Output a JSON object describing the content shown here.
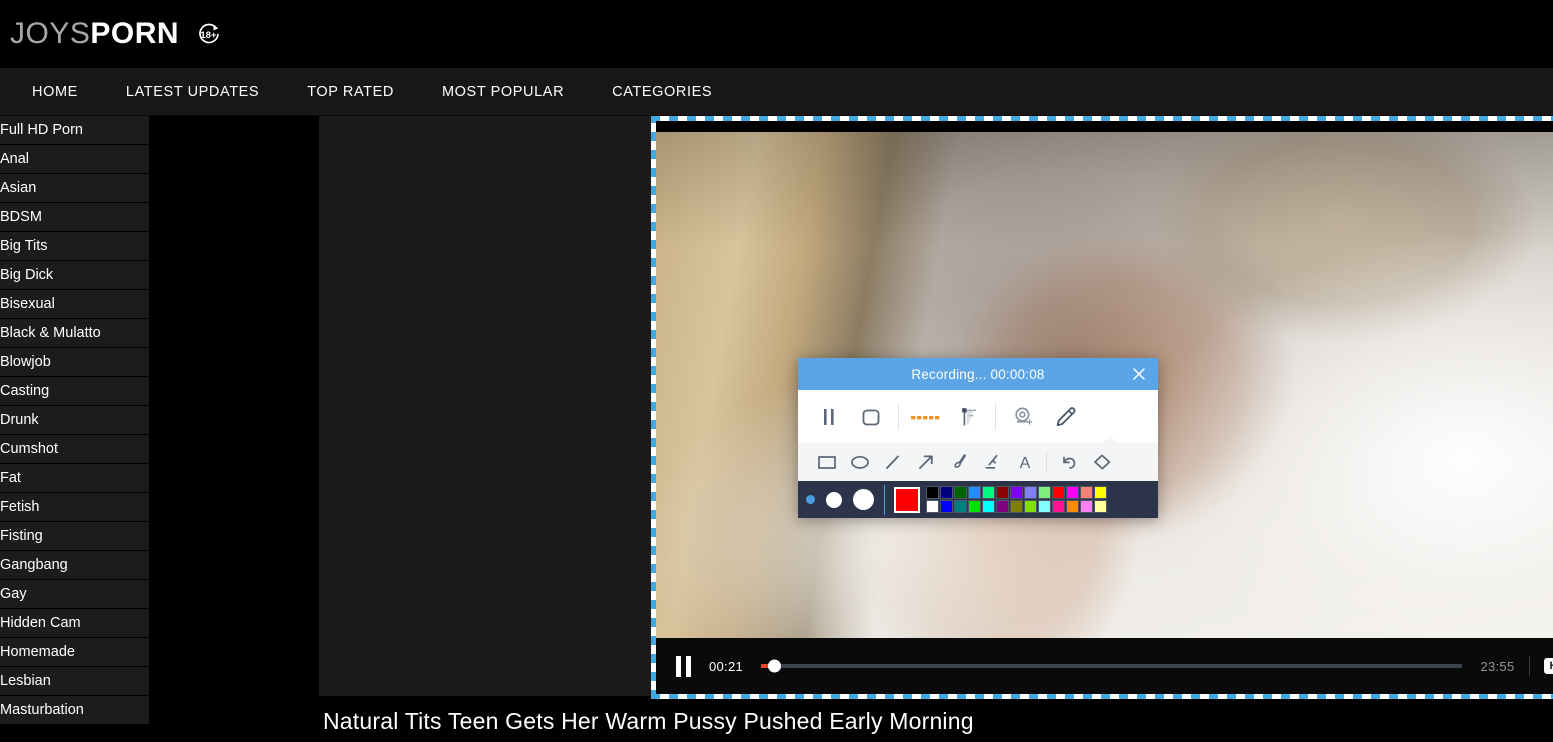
{
  "header": {
    "logo_primary": "JOYS",
    "logo_secondary": "PORN",
    "age_badge": "18+"
  },
  "nav": {
    "items": [
      {
        "label": "HOME"
      },
      {
        "label": "LATEST UPDATES"
      },
      {
        "label": "TOP RATED"
      },
      {
        "label": "MOST POPULAR"
      },
      {
        "label": "CATEGORIES"
      }
    ]
  },
  "sidebar": {
    "items": [
      {
        "label": "Full HD Porn"
      },
      {
        "label": "Anal"
      },
      {
        "label": "Asian"
      },
      {
        "label": "BDSM"
      },
      {
        "label": "Big Tits"
      },
      {
        "label": "Big Dick"
      },
      {
        "label": "Bisexual"
      },
      {
        "label": "Black & Mulatto"
      },
      {
        "label": "Blowjob"
      },
      {
        "label": "Casting"
      },
      {
        "label": "Drunk"
      },
      {
        "label": "Cumshot"
      },
      {
        "label": "Fat"
      },
      {
        "label": "Fetish"
      },
      {
        "label": "Fisting"
      },
      {
        "label": "Gangbang"
      },
      {
        "label": "Gay"
      },
      {
        "label": "Hidden Cam"
      },
      {
        "label": "Homemade"
      },
      {
        "label": "Lesbian"
      },
      {
        "label": "Masturbation"
      }
    ]
  },
  "video": {
    "title": "Natural Tits Teen Gets Her Warm Pussy Pushed Early Morning",
    "current_time": "00:21",
    "duration": "23:55",
    "progress_percent": 1.4,
    "quality_badge": "HD",
    "state": "playing",
    "controls": {
      "pause": "pause-button",
      "volume": "volume-button",
      "fullscreen": "fullscreen-button"
    }
  },
  "recorder": {
    "status_text": "Recording... 00:00:08",
    "close_label": "close",
    "toolbar": [
      {
        "name": "pause-recording",
        "icon": "pause-icon"
      },
      {
        "name": "stop-recording",
        "icon": "stop-icon"
      },
      {
        "name": "audio-level",
        "icon": "audio-waveform-icon"
      },
      {
        "name": "screenshot",
        "icon": "flag-capture-icon"
      },
      {
        "name": "webcam",
        "icon": "webcam-add-icon"
      },
      {
        "name": "annotate",
        "icon": "pencil-icon"
      }
    ],
    "draw_tools": [
      {
        "name": "rectangle-tool",
        "icon": "rectangle-icon"
      },
      {
        "name": "ellipse-tool",
        "icon": "ellipse-icon"
      },
      {
        "name": "line-tool",
        "icon": "line-icon"
      },
      {
        "name": "arrow-tool",
        "icon": "arrow-icon"
      },
      {
        "name": "brush-tool",
        "icon": "brush-icon"
      },
      {
        "name": "highlighter-tool",
        "icon": "highlighter-icon"
      },
      {
        "name": "text-tool",
        "icon": "text-a-icon"
      },
      {
        "name": "undo-tool",
        "icon": "undo-icon"
      },
      {
        "name": "eraser-tool",
        "icon": "eraser-icon"
      }
    ],
    "brush_sizes": [
      {
        "name": "brush-size-small",
        "selected": true
      },
      {
        "name": "brush-size-medium",
        "selected": false
      },
      {
        "name": "brush-size-large",
        "selected": false
      }
    ],
    "current_color": "#ff0000",
    "palette_row1": [
      "#000000",
      "#000080",
      "#006400",
      "#1e90ff",
      "#00fa7f",
      "#8b0000",
      "#8000ff",
      "#8080f0",
      "#80ef80",
      "#ff0000",
      "#ff00ff",
      "#fa8072",
      "#ffff00"
    ],
    "palette_row2": [
      "#ffffff",
      "#0000ff",
      "#008080",
      "#00e000",
      "#00ffff",
      "#800080",
      "#808000",
      "#80e000",
      "#80ffff",
      "#ff1493",
      "#ff8c00",
      "#ff80f0",
      "#ffff99"
    ],
    "header_color": "#5ba4e5",
    "region_border_color": "#3fa9e0"
  }
}
